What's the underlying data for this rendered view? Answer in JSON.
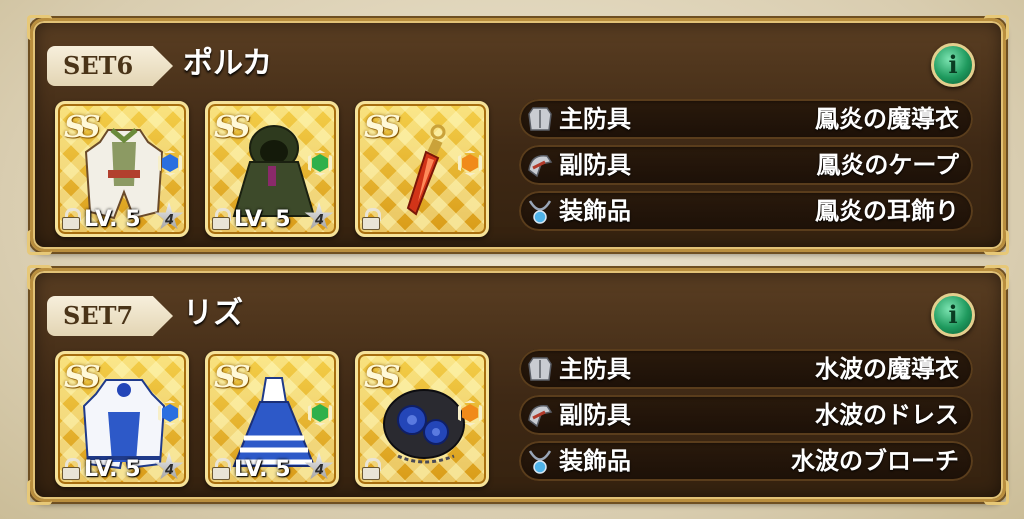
{
  "sets": [
    {
      "set_label": "SET6",
      "character": "ポルカ",
      "info_label": "i",
      "items": [
        {
          "rank": "SS",
          "level": "LV. 5",
          "stars": "4",
          "gem_color": "#2a6fe0",
          "art_icon": "white-robe-icon",
          "art_color": "#f2efe6"
        },
        {
          "rank": "SS",
          "level": "LV. 5",
          "stars": "4",
          "gem_color": "#2fb04a",
          "art_icon": "hooded-cape-icon",
          "art_color": "#3d4a2a"
        },
        {
          "rank": "SS",
          "gem_color": "#f08a1a",
          "art_icon": "red-crystal-earring-icon",
          "art_color": "#d23418"
        }
      ],
      "slots": [
        {
          "type": "主防具",
          "equip": "鳳炎の魔導衣",
          "icon": "armor-icon"
        },
        {
          "type": "副防具",
          "equip": "鳳炎のケープ",
          "icon": "helmet-icon"
        },
        {
          "type": "装飾品",
          "equip": "鳳炎の耳飾り",
          "icon": "necklace-icon"
        }
      ]
    },
    {
      "set_label": "SET7",
      "character": "リズ",
      "info_label": "i",
      "items": [
        {
          "rank": "SS",
          "level": "LV. 5",
          "stars": "4",
          "gem_color": "#2a6fe0",
          "art_icon": "blue-white-robe-icon",
          "art_color": "#f4f6fb"
        },
        {
          "rank": "SS",
          "level": "LV. 5",
          "stars": "4",
          "gem_color": "#2fb04a",
          "art_icon": "blue-dress-icon",
          "art_color": "#2d59c8"
        },
        {
          "rank": "SS",
          "gem_color": "#f08a1a",
          "art_icon": "blue-rose-brooch-icon",
          "art_color": "#2446b8"
        }
      ],
      "slots": [
        {
          "type": "主防具",
          "equip": "水波の魔導衣",
          "icon": "armor-icon"
        },
        {
          "type": "副防具",
          "equip": "水波のドレス",
          "icon": "helmet-icon"
        },
        {
          "type": "装飾品",
          "equip": "水波のブローチ",
          "icon": "necklace-icon"
        }
      ]
    }
  ]
}
